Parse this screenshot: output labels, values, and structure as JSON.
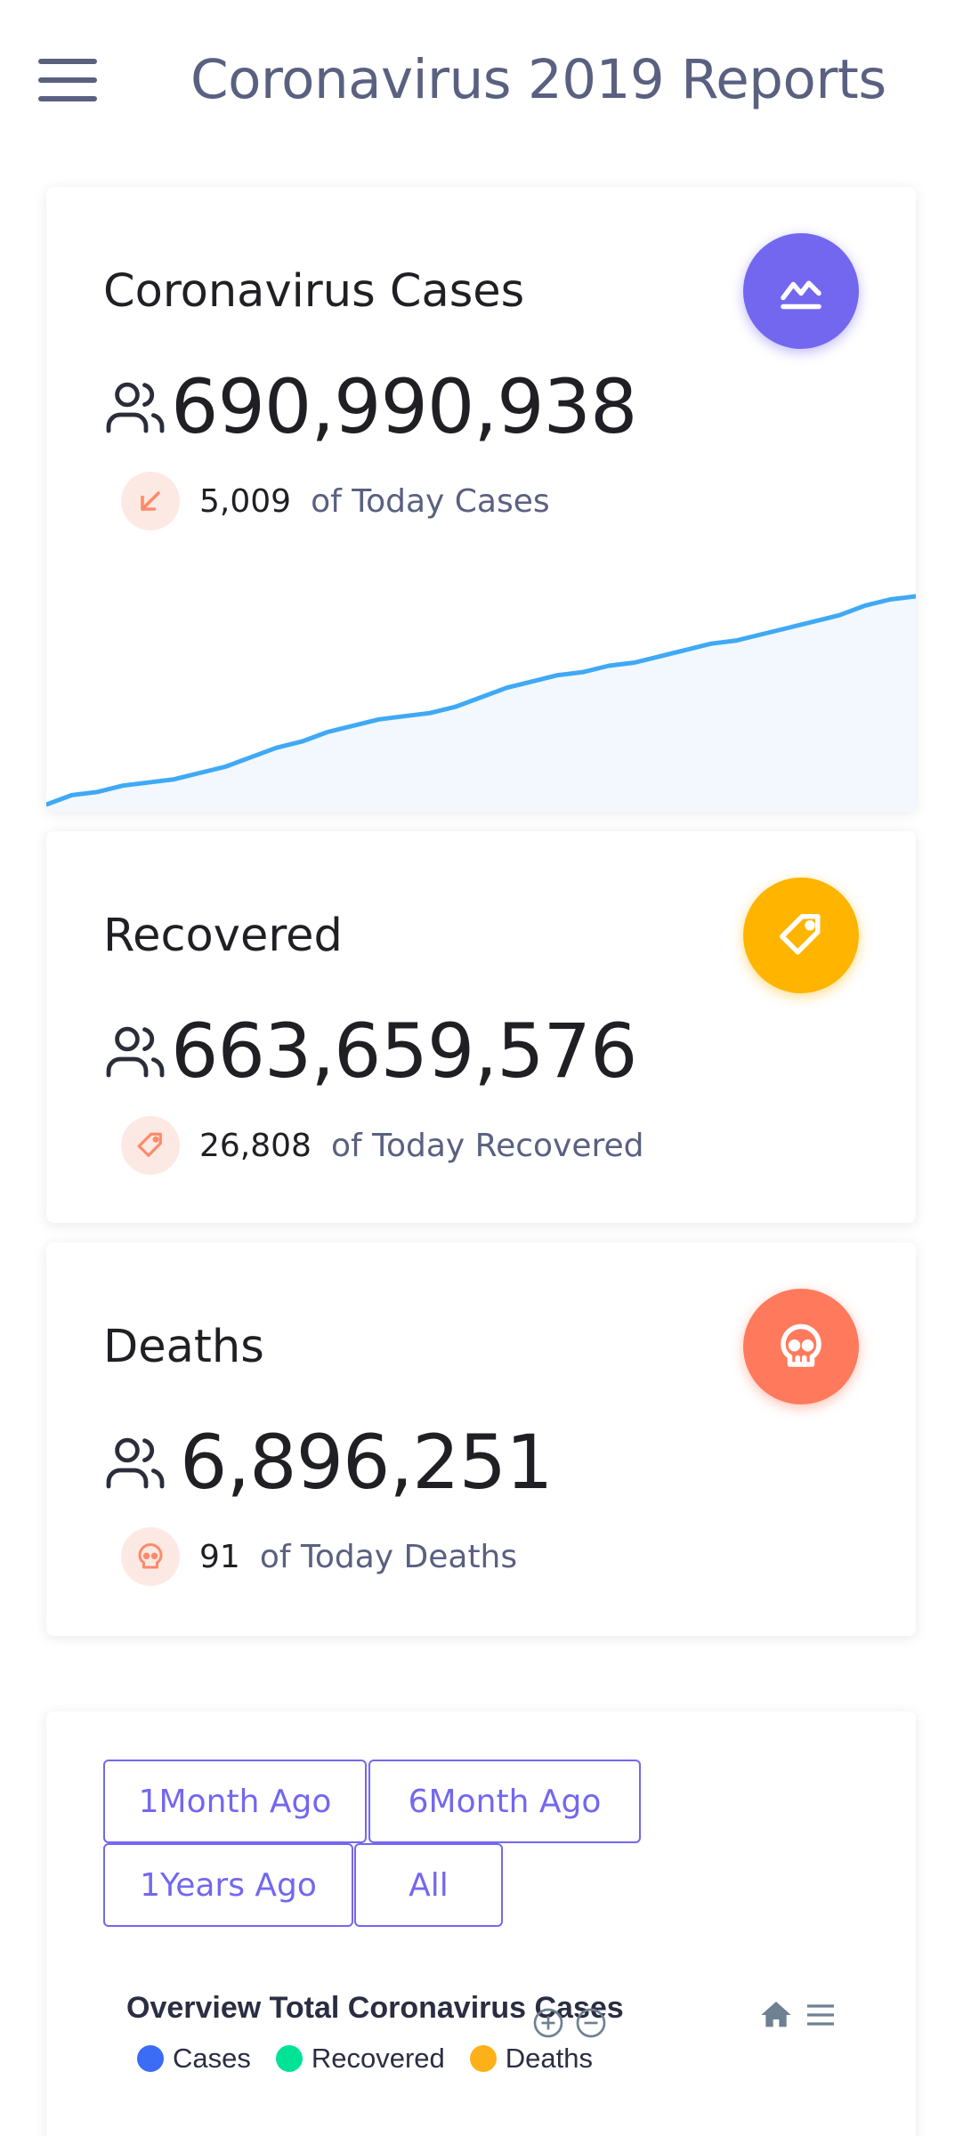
{
  "header": {
    "title": "Coronavirus 2019 Reports",
    "menu_icon": "hamburger-menu-icon"
  },
  "colors": {
    "primary": "#7367f0",
    "warning": "#ffb400",
    "danger": "#ff7a5c",
    "info": "#3fa9f5",
    "text_muted": "#5a6080"
  },
  "cards": {
    "cases": {
      "title": "Coronavirus Cases",
      "value": "690,990,938",
      "today_value": "5,009",
      "today_label": "of Today Cases",
      "icon": "trending-chart-icon",
      "badge_icon": "arrow-down-left-icon",
      "icon_color": "#7367f0"
    },
    "recovered": {
      "title": "Recovered",
      "value": "663,659,576",
      "today_value": "26,808",
      "today_label": "of Today Recovered",
      "icon": "tag-icon",
      "badge_icon": "tag-icon",
      "icon_color": "#ffb400"
    },
    "deaths": {
      "title": "Deaths",
      "value": "6,896,251",
      "today_value": "91",
      "today_label": "of Today Deaths",
      "icon": "skull-icon",
      "badge_icon": "skull-icon",
      "icon_color": "#ff7a5c"
    }
  },
  "cases_trend": [
    4,
    7,
    8,
    10,
    11,
    12,
    14,
    16,
    19,
    22,
    24,
    27,
    29,
    31,
    32,
    33,
    35,
    38,
    41,
    43,
    45,
    46,
    48,
    49,
    51,
    53,
    55,
    56,
    58,
    60,
    62,
    64,
    67,
    69,
    70
  ],
  "overview": {
    "ranges": [
      "1Month Ago",
      "6Month Ago",
      "1Years Ago",
      "All"
    ],
    "title": "Overview Total Coronavirus Cases",
    "legend": [
      {
        "label": "Cases",
        "color": "#3b6cf6"
      },
      {
        "label": "Recovered",
        "color": "#00e396"
      },
      {
        "label": "Deaths",
        "color": "#feb019"
      }
    ],
    "tools": [
      "zoom-in-icon",
      "zoom-out-icon",
      "home-icon",
      "menu-icon"
    ]
  }
}
